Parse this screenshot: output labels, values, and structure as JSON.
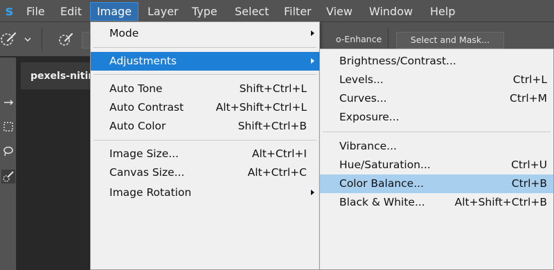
{
  "app": {
    "logo_text": "s"
  },
  "menubar": {
    "items": [
      "File",
      "Edit",
      "Image",
      "Layer",
      "Type",
      "Select",
      "Filter",
      "View",
      "Window",
      "Help"
    ],
    "active": "Image"
  },
  "options_bar": {
    "auto_enhance_label": "o-Enhance",
    "select_mask_label": "Select and Mask..."
  },
  "document": {
    "tab_title": "pexels-nitin"
  },
  "image_menu": {
    "mode": "Mode",
    "adjustments": "Adjustments",
    "auto_tone": {
      "label": "Auto Tone",
      "shortcut": "Shift+Ctrl+L"
    },
    "auto_contrast": {
      "label": "Auto Contrast",
      "shortcut": "Alt+Shift+Ctrl+L"
    },
    "auto_color": {
      "label": "Auto Color",
      "shortcut": "Shift+Ctrl+B"
    },
    "image_size": {
      "label": "Image Size...",
      "shortcut": "Alt+Ctrl+I"
    },
    "canvas_size": {
      "label": "Canvas Size...",
      "shortcut": "Alt+Ctrl+C"
    },
    "image_rotation": "Image Rotation"
  },
  "adjustments_menu": {
    "brightness_contrast": {
      "label": "Brightness/Contrast...",
      "shortcut": ""
    },
    "levels": {
      "label": "Levels...",
      "shortcut": "Ctrl+L"
    },
    "curves": {
      "label": "Curves...",
      "shortcut": "Ctrl+M"
    },
    "exposure": {
      "label": "Exposure...",
      "shortcut": ""
    },
    "vibrance": {
      "label": "Vibrance...",
      "shortcut": ""
    },
    "hue_saturation": {
      "label": "Hue/Saturation...",
      "shortcut": "Ctrl+U"
    },
    "color_balance": {
      "label": "Color Balance...",
      "shortcut": "Ctrl+B"
    },
    "black_white": {
      "label": "Black & White...",
      "shortcut": "Alt+Shift+Ctrl+B"
    }
  },
  "colors": {
    "menubar_bg": "#535353",
    "active_menu": "#2f6fb0",
    "menu_highlight": "#1e7fd6",
    "hover_highlight": "#a9cfee",
    "logo_blue": "#2fa3f7"
  },
  "icons": [
    "brush-icon",
    "chevron-down-icon",
    "move-tool-icon",
    "marquee-tool-icon",
    "lasso-tool-icon",
    "quick-selection-tool-icon",
    "submenu-arrow-icon"
  ]
}
